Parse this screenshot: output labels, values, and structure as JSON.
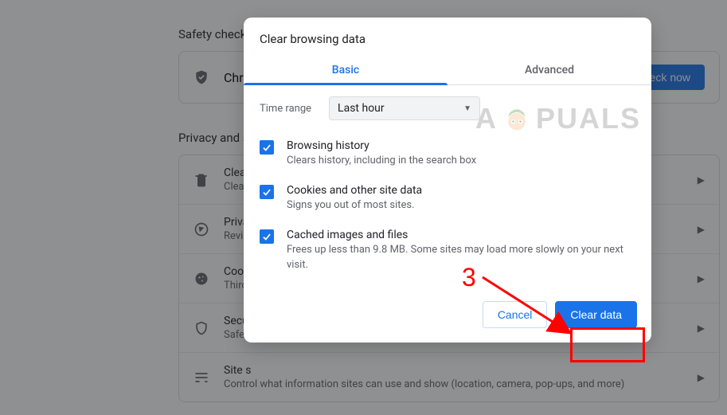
{
  "bg": {
    "safety_title": "Safety check",
    "safety_row_label": "Chrome",
    "check_now": "eck now",
    "privacy_title": "Privacy and s",
    "rows": [
      {
        "title": "Clear",
        "sub": "Clear"
      },
      {
        "title": "Priva",
        "sub": "Revi"
      },
      {
        "title": "Cook",
        "sub": "Third"
      },
      {
        "title": "Secu",
        "sub": "Safe"
      },
      {
        "title": "Site s",
        "sub": "Control what information sites can use and show (location, camera, pop-ups, and more)"
      }
    ]
  },
  "modal": {
    "title": "Clear browsing data",
    "tab_basic": "Basic",
    "tab_advanced": "Advanced",
    "time_label": "Time range",
    "time_value": "Last hour",
    "options": [
      {
        "title": "Browsing history",
        "sub": "Clears history, including in the search box",
        "checked": true
      },
      {
        "title": "Cookies and other site data",
        "sub": "Signs you out of most sites.",
        "checked": true
      },
      {
        "title": "Cached images and files",
        "sub": "Frees up less than 9.8 MB. Some sites may load more slowly on your next visit.",
        "checked": true
      }
    ],
    "cancel": "Cancel",
    "clear": "Clear data"
  },
  "annotation": {
    "number": "3"
  },
  "watermark": {
    "left": "A",
    "right": "PUALS"
  }
}
